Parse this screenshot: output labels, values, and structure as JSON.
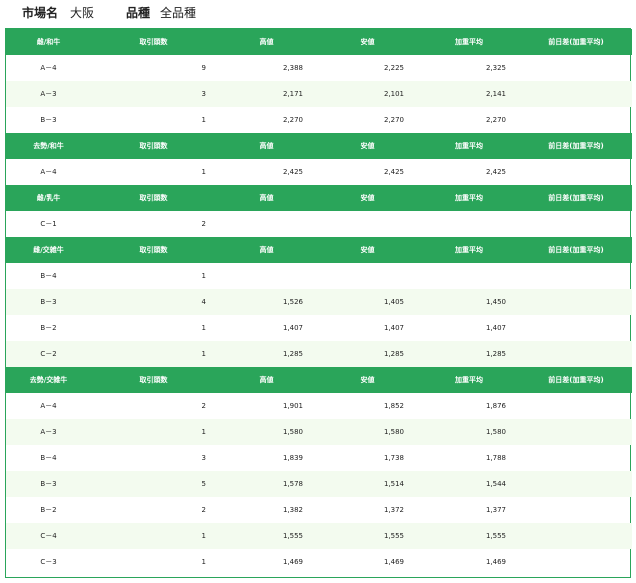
{
  "header": {
    "market_label": "市場名",
    "market_value": "大阪",
    "variety_label": "品種",
    "variety_value": "全品種"
  },
  "columns": [
    "取引頭数",
    "高値",
    "安値",
    "加重平均",
    "前日差(加重平均)"
  ],
  "sections": [
    {
      "category": "雌/和牛",
      "rows": [
        {
          "grade": "A－4",
          "count": "9",
          "high": "2,388",
          "low": "2,225",
          "avg": "2,325",
          "diff": ""
        },
        {
          "grade": "A－3",
          "count": "3",
          "high": "2,171",
          "low": "2,101",
          "avg": "2,141",
          "diff": ""
        },
        {
          "grade": "B－3",
          "count": "1",
          "high": "2,270",
          "low": "2,270",
          "avg": "2,270",
          "diff": ""
        }
      ]
    },
    {
      "category": "去勢/和牛",
      "rows": [
        {
          "grade": "A－4",
          "count": "1",
          "high": "2,425",
          "low": "2,425",
          "avg": "2,425",
          "diff": ""
        }
      ]
    },
    {
      "category": "雌/乳牛",
      "rows": [
        {
          "grade": "C－1",
          "count": "2",
          "high": "",
          "low": "",
          "avg": "",
          "diff": ""
        }
      ]
    },
    {
      "category": "雌/交雑牛",
      "rows": [
        {
          "grade": "B－4",
          "count": "1",
          "high": "",
          "low": "",
          "avg": "",
          "diff": ""
        },
        {
          "grade": "B－3",
          "count": "4",
          "high": "1,526",
          "low": "1,405",
          "avg": "1,450",
          "diff": ""
        },
        {
          "grade": "B－2",
          "count": "1",
          "high": "1,407",
          "low": "1,407",
          "avg": "1,407",
          "diff": ""
        },
        {
          "grade": "C－2",
          "count": "1",
          "high": "1,285",
          "low": "1,285",
          "avg": "1,285",
          "diff": ""
        }
      ]
    },
    {
      "category": "去勢/交雑牛",
      "rows": [
        {
          "grade": "A－4",
          "count": "2",
          "high": "1,901",
          "low": "1,852",
          "avg": "1,876",
          "diff": ""
        },
        {
          "grade": "A－3",
          "count": "1",
          "high": "1,580",
          "low": "1,580",
          "avg": "1,580",
          "diff": ""
        },
        {
          "grade": "B－4",
          "count": "3",
          "high": "1,839",
          "low": "1,738",
          "avg": "1,788",
          "diff": ""
        },
        {
          "grade": "B－3",
          "count": "5",
          "high": "1,578",
          "low": "1,514",
          "avg": "1,544",
          "diff": ""
        },
        {
          "grade": "B－2",
          "count": "2",
          "high": "1,382",
          "low": "1,372",
          "avg": "1,377",
          "diff": ""
        },
        {
          "grade": "C－4",
          "count": "1",
          "high": "1,555",
          "low": "1,555",
          "avg": "1,555",
          "diff": ""
        },
        {
          "grade": "C－3",
          "count": "1",
          "high": "1,469",
          "low": "1,469",
          "avg": "1,469",
          "diff": ""
        }
      ]
    }
  ]
}
